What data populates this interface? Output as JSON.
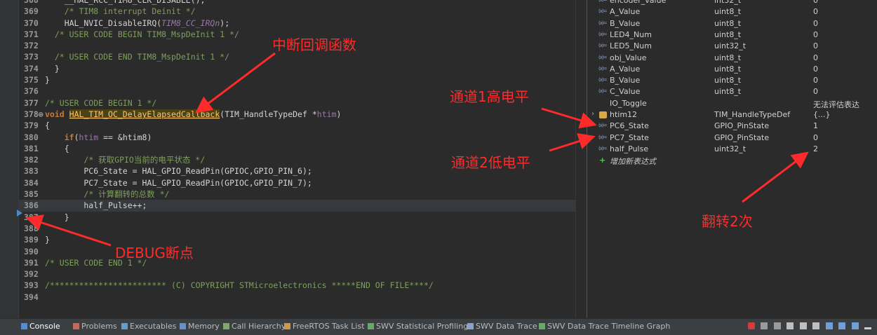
{
  "editor": {
    "lines": [
      {
        "n": "368",
        "tokens": [
          {
            "t": "plain",
            "s": "    __HAL_RCC_TIM8_CLK_DISABLE();"
          }
        ]
      },
      {
        "n": "369",
        "tokens": [
          {
            "t": "plain",
            "s": "    "
          },
          {
            "t": "comment",
            "s": "/* TIM8 interrupt Deinit */"
          }
        ]
      },
      {
        "n": "370",
        "tokens": [
          {
            "t": "plain",
            "s": "    HAL_NVIC_DisableIRQ("
          },
          {
            "t": "const",
            "s": "TIM8_CC_IRQn"
          },
          {
            "t": "plain",
            "s": ");"
          }
        ]
      },
      {
        "n": "371",
        "tokens": [
          {
            "t": "plain",
            "s": "  "
          },
          {
            "t": "comment",
            "s": "/* USER CODE BEGIN TIM8_MspDeInit 1 */"
          }
        ]
      },
      {
        "n": "372",
        "tokens": []
      },
      {
        "n": "373",
        "tokens": [
          {
            "t": "plain",
            "s": "  "
          },
          {
            "t": "comment",
            "s": "/* USER CODE END TIM8_MspDeInit 1 */"
          }
        ]
      },
      {
        "n": "374",
        "tokens": [
          {
            "t": "plain",
            "s": "  }"
          }
        ]
      },
      {
        "n": "375",
        "tokens": [
          {
            "t": "plain",
            "s": "}"
          }
        ]
      },
      {
        "n": "376",
        "tokens": []
      },
      {
        "n": "377",
        "tokens": [
          {
            "t": "comment",
            "s": "/* USER CODE BEGIN 1 */"
          }
        ]
      },
      {
        "n": "378⊕",
        "tokens": [
          {
            "t": "keyword",
            "s": "void"
          },
          {
            "t": "plain",
            "s": " "
          },
          {
            "t": "func",
            "s": "HAL_TIM_OC_DelayElapsedCallback"
          },
          {
            "t": "plain",
            "s": "(TIM_HandleTypeDef *"
          },
          {
            "t": "param",
            "s": "htim"
          },
          {
            "t": "plain",
            "s": ")"
          }
        ]
      },
      {
        "n": "379",
        "tokens": [
          {
            "t": "plain",
            "s": "{"
          }
        ]
      },
      {
        "n": "380",
        "tokens": [
          {
            "t": "plain",
            "s": "    "
          },
          {
            "t": "keyword",
            "s": "if"
          },
          {
            "t": "plain",
            "s": "("
          },
          {
            "t": "param",
            "s": "htim"
          },
          {
            "t": "plain",
            "s": " == &htim8)"
          }
        ]
      },
      {
        "n": "381",
        "tokens": [
          {
            "t": "plain",
            "s": "    {"
          }
        ]
      },
      {
        "n": "382",
        "tokens": [
          {
            "t": "plain",
            "s": "        "
          },
          {
            "t": "comment",
            "s": "/* 获取GPIO当前的电平状态 */"
          }
        ]
      },
      {
        "n": "383",
        "tokens": [
          {
            "t": "plain",
            "s": "        PC6_State = HAL_GPIO_ReadPin(GPIOC,GPIO_PIN_6);"
          }
        ]
      },
      {
        "n": "384",
        "tokens": [
          {
            "t": "plain",
            "s": "        PC7_State = HAL_GPIO_ReadPin(GPIOC,GPIO_PIN_7);"
          }
        ]
      },
      {
        "n": "385",
        "tokens": [
          {
            "t": "plain",
            "s": "        "
          },
          {
            "t": "comment",
            "s": "/* 计算翻转的总数 */"
          }
        ]
      },
      {
        "n": "386",
        "current": true,
        "tokens": [
          {
            "t": "plain",
            "s": "        half_Pulse++;"
          }
        ]
      },
      {
        "n": "387",
        "tokens": [
          {
            "t": "plain",
            "s": "    }"
          }
        ]
      },
      {
        "n": "388",
        "tokens": []
      },
      {
        "n": "389",
        "tokens": [
          {
            "t": "plain",
            "s": "}"
          }
        ]
      },
      {
        "n": "390",
        "tokens": []
      },
      {
        "n": "391",
        "tokens": [
          {
            "t": "comment",
            "s": "/* USER CODE END 1 */"
          }
        ]
      },
      {
        "n": "392",
        "tokens": []
      },
      {
        "n": "393",
        "tokens": [
          {
            "t": "comment",
            "s": "/************************ (C) COPYRIGHT STMicroelectronics *****END OF FILE****/"
          }
        ]
      },
      {
        "n": "394",
        "tokens": []
      }
    ]
  },
  "expressions": {
    "rows": [
      {
        "kind": "var",
        "name": "encoder_value",
        "type": "int32_t",
        "value": "0"
      },
      {
        "kind": "var",
        "name": "A_Value",
        "type": "uint8_t",
        "value": "0"
      },
      {
        "kind": "var",
        "name": "B_Value",
        "type": "uint8_t",
        "value": "0"
      },
      {
        "kind": "var",
        "name": "LED4_Num",
        "type": "uint8_t",
        "value": "0"
      },
      {
        "kind": "var",
        "name": "LED5_Num",
        "type": "uint32_t",
        "value": "0"
      },
      {
        "kind": "var",
        "name": "obj_Value",
        "type": "uint8_t",
        "value": "0"
      },
      {
        "kind": "var",
        "name": "A_Value",
        "type": "uint8_t",
        "value": "0"
      },
      {
        "kind": "var",
        "name": "B_Value",
        "type": "uint8_t",
        "value": "0"
      },
      {
        "kind": "var",
        "name": "C_Value",
        "type": "uint8_t",
        "value": "0"
      },
      {
        "kind": "plain",
        "name": "IO_Toggle",
        "type": "",
        "value": "无法评估表达"
      },
      {
        "kind": "struct",
        "name": "htim12",
        "type": "TIM_HandleTypeDef",
        "value": "{...}"
      },
      {
        "kind": "var",
        "name": "PC6_State",
        "type": "GPIO_PinState",
        "value": "1"
      },
      {
        "kind": "var",
        "name": "PC7_State",
        "type": "GPIO_PinState",
        "value": "0"
      },
      {
        "kind": "var",
        "name": "half_Pulse",
        "type": "uint32_t",
        "value": "2"
      },
      {
        "kind": "add",
        "name": "增加新表达式",
        "type": "",
        "value": ""
      }
    ]
  },
  "tabs": [
    {
      "label": "Console",
      "active": true,
      "icon": "console-icon",
      "color": "#4f8fd6"
    },
    {
      "label": "Problems",
      "icon": "problems-icon",
      "color": "#c46a5a"
    },
    {
      "label": "Executables",
      "icon": "executables-icon",
      "color": "#5a9fd6"
    },
    {
      "label": "Memory",
      "icon": "memory-icon",
      "color": "#6a8fc4"
    },
    {
      "label": "Call Hierarchy",
      "icon": "call-hierarchy-icon",
      "color": "#7fa86a"
    },
    {
      "label": "FreeRTOS Task List",
      "icon": "freertos-icon",
      "color": "#c89a4a"
    },
    {
      "label": "SWV Statistical Profiling",
      "icon": "swv-profiling-icon",
      "color": "#6aa86a"
    },
    {
      "label": "SWV Data Trace",
      "icon": "swv-data-trace-icon",
      "color": "#8aa4c8"
    },
    {
      "label": "SWV Data Trace Timeline Graph",
      "icon": "swv-timeline-icon",
      "color": "#6aa86a"
    }
  ],
  "annotations": {
    "interrupt_callback": "中断回调函数",
    "channel1_high": "通道1高电平",
    "channel2_low": "通道2低电平",
    "debug_breakpoint": "DEBUG断点",
    "toggle_twice": "翻转2次"
  },
  "colors": {
    "annotation": "#ff2b2b",
    "background": "#2b2b2b"
  }
}
